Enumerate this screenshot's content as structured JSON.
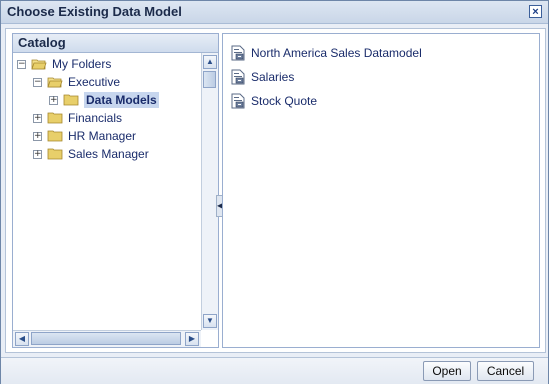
{
  "dialog": {
    "title": "Choose Existing Data Model",
    "close_icon": "close-icon"
  },
  "catalog": {
    "title": "Catalog",
    "tree": [
      {
        "label": "My Folders",
        "toggle": "−",
        "level": 0,
        "open": true
      },
      {
        "label": "Executive",
        "toggle": "−",
        "level": 1,
        "open": true
      },
      {
        "label": "Data Models",
        "toggle": "+",
        "level": 2,
        "selected": true
      },
      {
        "label": "Financials",
        "toggle": "+",
        "level": 1
      },
      {
        "label": "HR Manager",
        "toggle": "+",
        "level": 1
      },
      {
        "label": "Sales Manager",
        "toggle": "+",
        "level": 1
      }
    ]
  },
  "models": [
    {
      "label": "North America Sales Datamodel",
      "icon": "data-model-icon"
    },
    {
      "label": "Salaries",
      "icon": "data-model-icon"
    },
    {
      "label": "Stock Quote",
      "icon": "data-model-icon"
    }
  ],
  "scroll": {
    "up": "▲",
    "down": "▼",
    "left": "◀",
    "right": "▶",
    "splitter": "◀"
  },
  "buttons": {
    "open_label": "Open",
    "cancel_label": "Cancel"
  },
  "colors": {
    "accent": "#1a2c6b",
    "selection": "#c7d6ee",
    "folder": "#e8cf6a"
  }
}
